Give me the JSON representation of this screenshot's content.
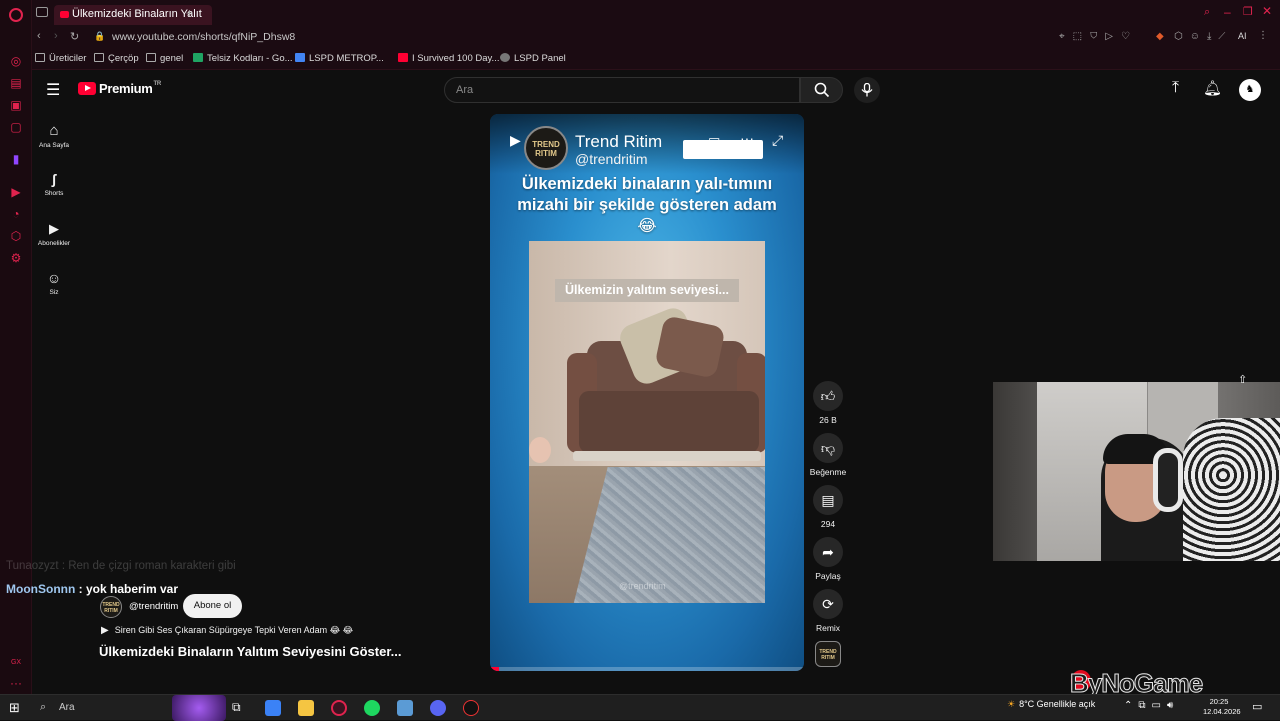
{
  "browser": {
    "tab_title": "Ülkemizdeki Binaların Yalıt",
    "url": "www.youtube.com/shorts/qfNiP_Dhsw8",
    "bookmarks": [
      {
        "label": "Üreticiler",
        "color": "#888888"
      },
      {
        "label": "Çerçöp",
        "color": "#888888"
      },
      {
        "label": "genel",
        "color": "#888888"
      },
      {
        "label": "Telsiz Kodları - Go...",
        "color": "#1fa463"
      },
      {
        "label": "LSPD METROP...",
        "color": "#4285f4"
      },
      {
        "label": "I Survived 100 Day...",
        "color": "#ff0033"
      },
      {
        "label": "LSPD Panel",
        "color": "#aaaaaa"
      }
    ],
    "ai_label": "AI"
  },
  "youtube": {
    "logo_text": "Premium",
    "logo_region": "TR",
    "search_placeholder": "Ara",
    "nav": [
      {
        "label": "Ana Sayfa",
        "icon": "home-icon"
      },
      {
        "label": "Shorts",
        "icon": "shorts-icon"
      },
      {
        "label": "Abonelikler",
        "icon": "subscriptions-icon"
      },
      {
        "label": "Siz",
        "icon": "you-icon"
      }
    ]
  },
  "video": {
    "channel_name": "Trend Ritim",
    "channel_handle": "@trendritim",
    "avatar_text": "TREND RITIM",
    "caption": "Ülkemizdeki binaların yalı-tımını mizahi bir şekilde gösteren adam 😂",
    "overlay_text": "Ülkemizin yalıtım seviyesi...",
    "watermark": "@trendritim",
    "progress": 0.03
  },
  "actions": {
    "like_count": "26 B",
    "dislike_label": "Beğenme",
    "comment_count": "294",
    "share_label": "Paylaş",
    "remix_label": "Remix"
  },
  "info": {
    "chat_line_1": "Tunaozyzt : Ren de çizgi roman karakteri gibi",
    "chat_user": "MoonSonnn",
    "chat_msg": " : yok haberim var",
    "channel_handle": "@trendritim",
    "subscribe_label": "Abone ol",
    "related_title": "Siren Gibi Ses Çıkaran Süpürgeye Tepki Veren Adam 😂 😂",
    "short_title": "Ülkemizdeki Binaların Yalıtım Seviyesini Göster..."
  },
  "overlay": {
    "brand": "ByNoGame"
  },
  "taskbar": {
    "search_placeholder": "Ara",
    "weather": "8°C  Genellikle açık",
    "time": "20:25",
    "date": "12.04.2026"
  }
}
